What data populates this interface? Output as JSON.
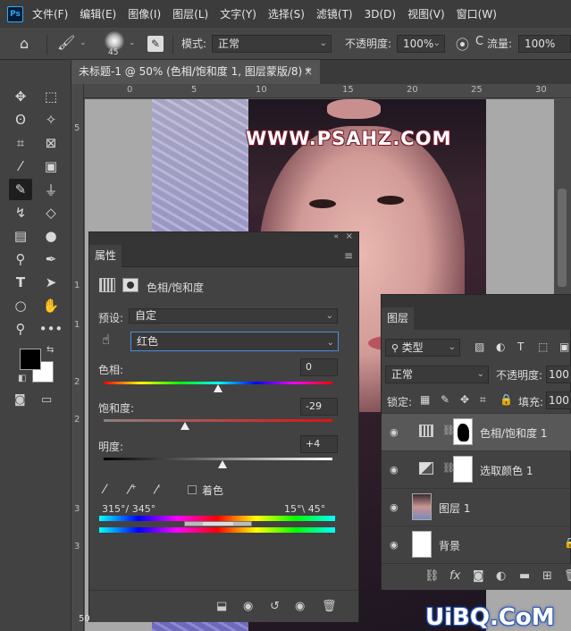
{
  "app": {
    "logo": "Ps"
  },
  "menu": [
    "文件(F)",
    "编辑(E)",
    "图像(I)",
    "图层(L)",
    "文字(Y)",
    "选择(S)",
    "滤镜(T)",
    "3D(D)",
    "视图(V)",
    "窗口(W)"
  ],
  "options_bar": {
    "brush_size": "45",
    "mode_label": "模式:",
    "mode_value": "正常",
    "opacity_label": "不透明度:",
    "opacity_value": "100%",
    "flow_label": "流量:",
    "flow_value": "100%"
  },
  "document": {
    "tab_title": "未标题-1 @ 50% (色相/饱和度 1, 图层蒙版/8) *",
    "close": "×",
    "zoom": "50"
  },
  "ruler": {
    "h_ticks": [
      "0",
      "5",
      "10",
      "15",
      "20",
      "25",
      "30"
    ],
    "v_ticks": [
      "5",
      "1",
      "1",
      "2",
      "2",
      "3",
      "3"
    ]
  },
  "watermark_text": "WWW.PSAHZ.COM",
  "properties": {
    "tab": "属性",
    "adjustment_title": "色相/饱和度",
    "preset_label": "预设:",
    "preset_value": "自定",
    "channel_value": "红色",
    "hue_label": "色相:",
    "hue_value": "0",
    "hue_level": 0.5,
    "saturation_label": "饱和度:",
    "saturation_value": "-29",
    "saturation_level": 0.355,
    "lightness_label": "明度:",
    "lightness_value": "+4",
    "lightness_level": 0.52,
    "colorize_label": "着色",
    "range_left": "315°/ 345°",
    "range_right": "15°\\ 45°"
  },
  "layers": {
    "tab": "图层",
    "filter_label": "类型",
    "blend_mode": "正常",
    "opacity_label": "不透明度:",
    "opacity_value": "100",
    "lock_label": "锁定:",
    "fill_label": "填充:",
    "fill_value": "100",
    "items": [
      {
        "name": "色相/饱和度 1",
        "selected": true
      },
      {
        "name": "选取颜色 1",
        "selected": false
      },
      {
        "name": "图层 1",
        "selected": false
      },
      {
        "name": "背景",
        "selected": false
      }
    ]
  },
  "site_watermark": "UiBQ.CoM"
}
